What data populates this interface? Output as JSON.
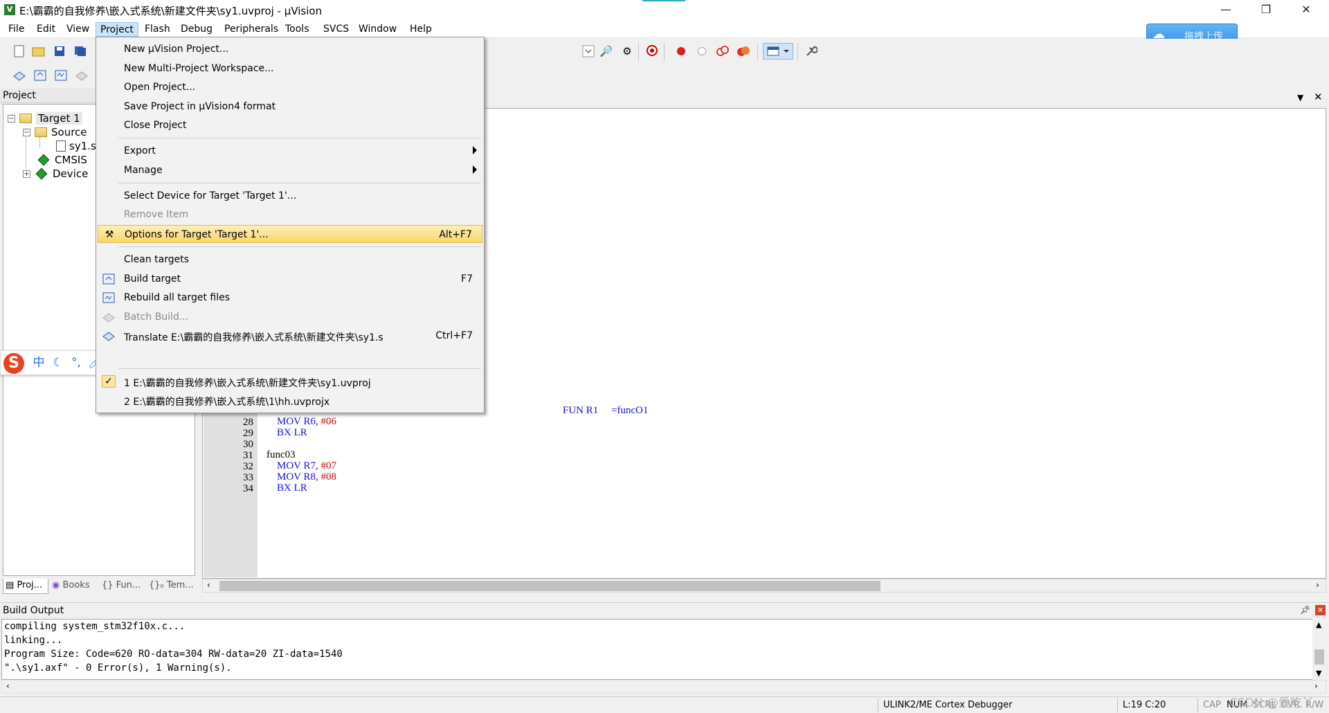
{
  "window": {
    "title": "E:\\霸霸的自我修养\\嵌入式系统\\新建文件夹\\sy1.uvproj - µVision",
    "app_icon": "V",
    "minimize": "—",
    "restore": "❐",
    "close": "✕"
  },
  "menubar": {
    "items": [
      "File",
      "Edit",
      "View",
      "Project",
      "Flash",
      "Debug",
      "Peripherals",
      "Tools",
      "SVCS",
      "Window",
      "Help"
    ],
    "active": "Project"
  },
  "upload_button": {
    "label": "拖拽上传",
    "icon": "cloud-icon",
    "color": "#3a91e6"
  },
  "project_panel": {
    "title": "Project",
    "tree": {
      "target": "Target 1",
      "source_group": "Source",
      "file": "sy1.s",
      "cmsis": "CMSIS",
      "device": "Device"
    },
    "tabs": [
      "Proj...",
      "Books",
      "{} Fun...",
      "{}₀ Tem..."
    ]
  },
  "project_menu": {
    "items": [
      {
        "label": "New µVision Project...",
        "shortcut": ""
      },
      {
        "label": "New Multi-Project Workspace...",
        "shortcut": ""
      },
      {
        "label": "Open Project...",
        "shortcut": ""
      },
      {
        "label": "Save Project in µVision4 format",
        "shortcut": ""
      },
      {
        "label": "Close Project",
        "shortcut": ""
      },
      {
        "label": "Export",
        "shortcut": ""
      },
      {
        "label": "Manage",
        "shortcut": ""
      },
      {
        "label": "Select Device for Target 'Target 1'...",
        "shortcut": ""
      },
      {
        "label": "Remove Item",
        "shortcut": ""
      },
      {
        "label": "Options for Target 'Target 1'...",
        "shortcut": "Alt+F7"
      },
      {
        "label": "Clean targets",
        "shortcut": ""
      },
      {
        "label": "Build target",
        "shortcut": "F7"
      },
      {
        "label": "Rebuild all target files",
        "shortcut": ""
      },
      {
        "label": "Batch Build...",
        "shortcut": ""
      },
      {
        "label": "Translate E:\\霸霸的自我修养\\嵌入式系统\\新建文件夹\\sy1.s",
        "shortcut": "Ctrl+F7"
      },
      {
        "label": "1 E:\\霸霸的自我修养\\嵌入式系统\\新建文件夹\\sy1.uvproj",
        "shortcut": ""
      },
      {
        "label": "2 E:\\霸霸的自我修养\\嵌入式系统\\1\\hh.uvprojx",
        "shortcut": ""
      }
    ],
    "highlighted_color": "#f8d66a"
  },
  "editor": {
    "lines": [
      {
        "no": "28",
        "indent": "    ",
        "op": "MOV",
        "arg1": "R6,",
        "arg2": "#06"
      },
      {
        "no": "29",
        "indent": "    ",
        "op": "BX",
        "arg1": "LR",
        "arg2": ""
      },
      {
        "no": "30",
        "indent": "",
        "op": "",
        "arg1": "",
        "arg2": ""
      },
      {
        "no": "31",
        "indent": "",
        "op": "",
        "arg1": "func03",
        "arg2": ""
      },
      {
        "no": "32",
        "indent": "    ",
        "op": "MOV",
        "arg1": "R7,",
        "arg2": "#07"
      },
      {
        "no": "33",
        "indent": "    ",
        "op": "MOV",
        "arg1": "R8,",
        "arg2": "#08"
      },
      {
        "no": "34",
        "indent": "    ",
        "op": "BX",
        "arg1": "LR",
        "arg2": ""
      }
    ],
    "partial_line": "FUN R1     =funcO1"
  },
  "build_output": {
    "title": "Build Output",
    "lines": [
      "compiling system_stm32f10x.c...",
      "linking...",
      "Program Size: Code=620 RO-data=304 RW-data=20 ZI-data=1540",
      "\".\\sy1.axf\" - 0 Error(s), 1 Warning(s)."
    ]
  },
  "statusbar": {
    "debugger": "ULINK2/ME Cortex Debugger",
    "position": "L:19 C:20",
    "cap": "CAP",
    "num": "NUM",
    "scrl": "SCRL",
    "ovr": "OVR",
    "rw": "R/W",
    "watermark": "CSDN @爱吃丫"
  },
  "ime_bar": {
    "logo": "S",
    "mode": "中",
    "icons": [
      "moon-icon",
      "punctuation-icon",
      "microphone-icon",
      "keyboard-icon",
      "user-icon",
      "shirt-icon",
      "wrench-icon"
    ]
  }
}
